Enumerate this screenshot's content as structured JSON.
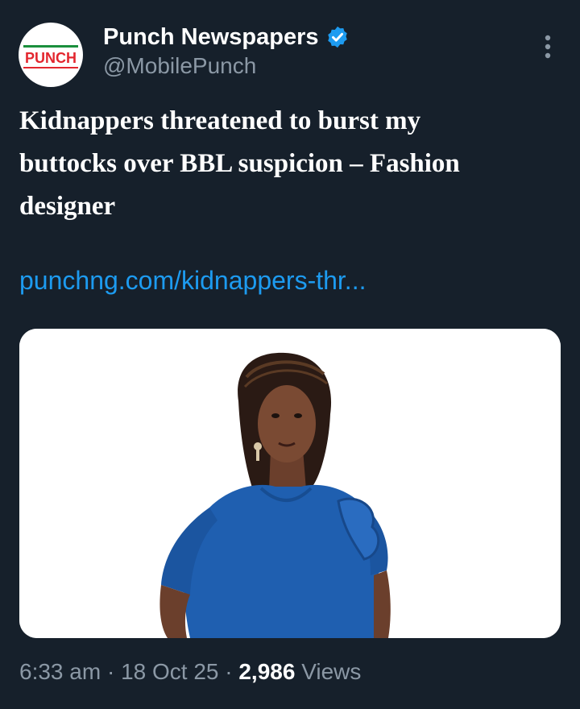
{
  "account": {
    "display_name": "Punch Newspapers",
    "handle": "@MobilePunch",
    "avatar_text": "PUNCH",
    "verified": true
  },
  "tweet": {
    "text_lines": [
      "Kidnappers threatened to burst my",
      "buttocks over BBL suspicion – Fashion",
      "designer"
    ],
    "link_text": "punchng.com/kidnappers-thr..."
  },
  "meta": {
    "time": "6:33 am",
    "separator": "·",
    "date": "18 Oct 25",
    "views_count": "2,986",
    "views_label": "Views"
  },
  "icons": {
    "more": "more-vertical-icon",
    "verified": "verified-badge-icon"
  },
  "colors": {
    "background": "#16202b",
    "link": "#1d9bf0",
    "secondary_text": "#8b98a5",
    "verified": "#1d9bf0",
    "brand_red": "#e3262e",
    "brand_green": "#1a8f3c"
  }
}
